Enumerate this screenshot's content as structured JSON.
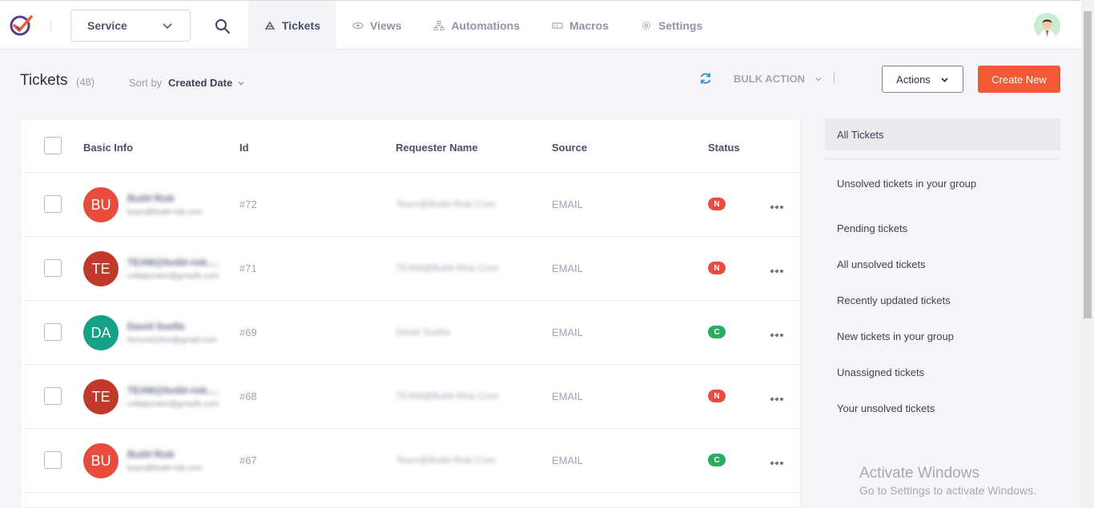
{
  "header": {
    "product_select": "Service",
    "nav": [
      {
        "label": "Tickets",
        "icon": "ticket-icon",
        "active": true
      },
      {
        "label": "Views",
        "icon": "eye-icon",
        "active": false
      },
      {
        "label": "Automations",
        "icon": "flow-icon",
        "active": false
      },
      {
        "label": "Macros",
        "icon": "macro-icon",
        "active": false
      },
      {
        "label": "Settings",
        "icon": "gear-icon",
        "active": false
      }
    ]
  },
  "page": {
    "title": "Tickets",
    "count": "(48)",
    "sort_label": "Sort by",
    "sort_value": "Created Date",
    "bulk_action": "BULK ACTION",
    "actions_label": "Actions",
    "create_label": "Create New"
  },
  "table": {
    "columns": [
      "Basic Info",
      "Id",
      "Requester Name",
      "Source",
      "Status"
    ],
    "rows": [
      {
        "initials": "BU",
        "avatar_color": "#e74c3c",
        "name": "Build Risk",
        "email": "team@build-risk.com",
        "id": "#72",
        "requester": "Team@Build-Risk.Com",
        "source": "EMAIL",
        "status": "N",
        "status_color": "#e74c3c"
      },
      {
        "initials": "TE",
        "avatar_color": "#c0392b",
        "name": "TEAM@build-risk.com",
        "email": "collaborator@growth.com",
        "id": "#71",
        "requester": "TEAM@Build-Risk.Com",
        "source": "EMAIL",
        "status": "N",
        "status_color": "#e74c3c"
      },
      {
        "initials": "DA",
        "avatar_color": "#16a085",
        "name": "David Suella",
        "email": "fortune01fire@gmail.com",
        "id": "#69",
        "requester": "David Suella",
        "source": "EMAIL",
        "status": "C",
        "status_color": "#27ae60"
      },
      {
        "initials": "TE",
        "avatar_color": "#c0392b",
        "name": "TEAM@build-risk.com",
        "email": "collaborator@growth.com",
        "id": "#68",
        "requester": "TEAM@Build-Risk.Com",
        "source": "EMAIL",
        "status": "N",
        "status_color": "#e74c3c"
      },
      {
        "initials": "BU",
        "avatar_color": "#e74c3c",
        "name": "Build Risk",
        "email": "team@build-risk.com",
        "id": "#67",
        "requester": "Team@Build-Risk.Com",
        "source": "EMAIL",
        "status": "C",
        "status_color": "#27ae60"
      }
    ]
  },
  "sidebar": {
    "active": "All Tickets",
    "items": [
      "Unsolved tickets in your group",
      "Pending tickets",
      "All unsolved tickets",
      "Recently updated tickets",
      "New tickets in your group",
      "Unassigned tickets",
      "Your unsolved tickets"
    ]
  },
  "watermark": {
    "title": "Activate Windows",
    "subtitle": "Go to Settings to activate Windows."
  },
  "colors": {
    "accent": "#f15a35",
    "nav_active_bg": "#f4f4f7",
    "refresh": "#2d8fd5"
  }
}
